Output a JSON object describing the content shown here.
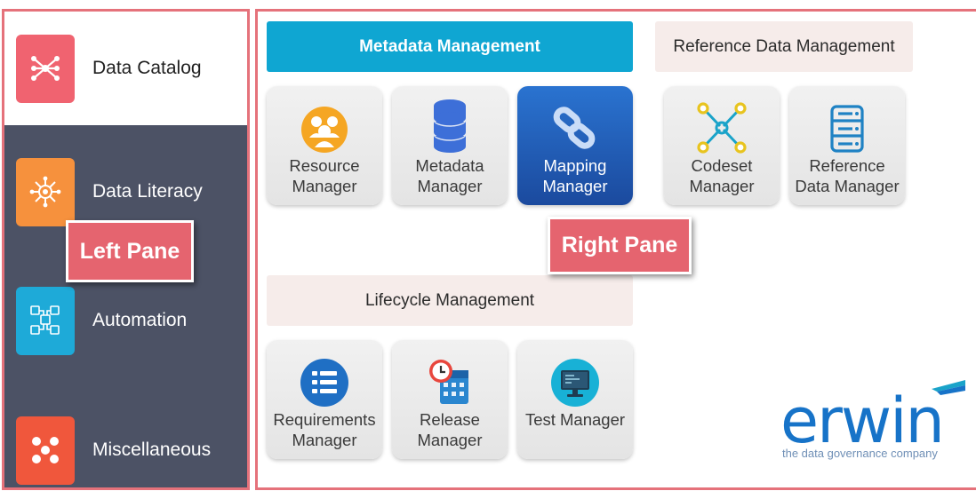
{
  "colors": {
    "accent": "#0fa6d2",
    "callout": "#e5646f",
    "sidebar": "#4c5265",
    "selected_tile": "#2a73d0",
    "logo": "#1773c8"
  },
  "left_pane": {
    "items": [
      {
        "label": "Data Catalog",
        "icon": "data-catalog-icon",
        "color": "#f06370"
      },
      {
        "label": "Data Literacy",
        "icon": "data-literacy-icon",
        "color": "#f6913d"
      },
      {
        "label": "Automation",
        "icon": "automation-icon",
        "color": "#1eaad8"
      },
      {
        "label": "Miscellaneous",
        "icon": "miscellaneous-icon",
        "color": "#f0573c"
      }
    ],
    "callout": "Left Pane"
  },
  "right_pane": {
    "callout": "Right Pane",
    "sections": {
      "metadata": {
        "title": "Metadata Management"
      },
      "reference": {
        "title": "Reference Data Management"
      },
      "lifecycle": {
        "title": "Lifecycle Management"
      }
    },
    "tiles": {
      "resource_manager": "Resource\nManager",
      "metadata_manager": "Metadata\nManager",
      "mapping_manager": "Mapping\nManager",
      "codeset_manager": "Codeset\nManager",
      "reference_data_manager": "Reference\nData Manager",
      "requirements_manager": "Requirements\nManager",
      "release_manager": "Release\nManager",
      "test_manager": "Test Manager"
    }
  },
  "logo": {
    "word": "erwin",
    "tagline": "the data governance company"
  }
}
